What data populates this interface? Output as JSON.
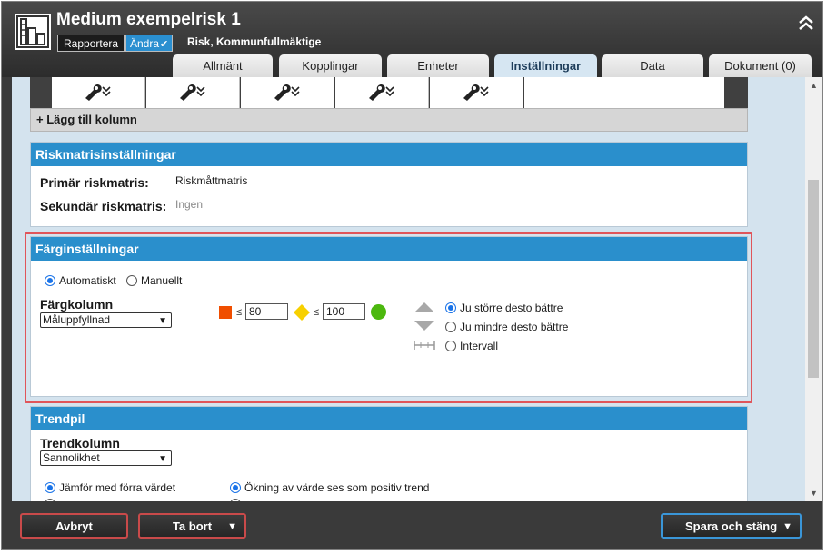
{
  "header": {
    "title": "Medium exempelrisk 1",
    "report_label": "Rapportera",
    "change_label": "Ändra",
    "subtitle": "Risk, Kommunfullmäktige"
  },
  "tabs": [
    {
      "label": "Allmänt",
      "active": false
    },
    {
      "label": "Kopplingar",
      "active": false
    },
    {
      "label": "Enheter",
      "active": false
    },
    {
      "label": "Inställningar",
      "active": true
    },
    {
      "label": "Data",
      "active": false
    },
    {
      "label": "Dokument (0)",
      "active": false
    }
  ],
  "columns": {
    "add_column_label": "+ Lägg till kolumn"
  },
  "riskmatrix": {
    "heading": "Riskmatrisinställningar",
    "primary_label": "Primär riskmatris:",
    "primary_value": "Riskmåttmatris",
    "secondary_label": "Sekundär riskmatris:",
    "secondary_value": "Ingen"
  },
  "color_settings": {
    "heading": "Färginställningar",
    "auto_label": "Automatiskt",
    "manual_label": "Manuellt",
    "mode": "Automatiskt",
    "column_label": "Färgkolumn",
    "column_value": "Måluppfyllnad",
    "threshold_red": "80",
    "threshold_yellow": "100",
    "le_symbol": "≤",
    "colors": {
      "red": "#f04e00",
      "yellow": "#f7d000",
      "green": "#4cb80e"
    },
    "direction_options": [
      "Ju större desto bättre",
      "Ju mindre desto bättre",
      "Intervall"
    ],
    "direction_selected": "Ju större desto bättre"
  },
  "trend": {
    "heading": "Trendpil",
    "column_label": "Trendkolumn",
    "column_value": "Sannolikhet",
    "compare_label": "Jämför med förra värdet",
    "increase_label": "Ökning av värde ses som positiv trend"
  },
  "footer": {
    "cancel_label": "Avbryt",
    "delete_label": "Ta bort",
    "save_close_label": "Spara och stäng"
  }
}
